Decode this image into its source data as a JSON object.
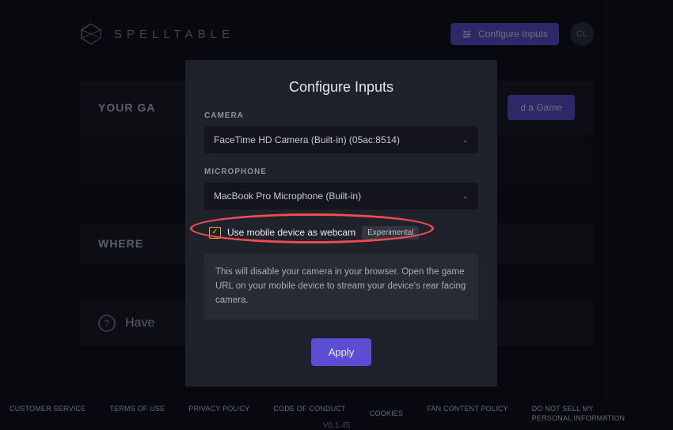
{
  "brand": {
    "name": "SPELLTABLE"
  },
  "topbar": {
    "config_label": "Configure Inputs",
    "avatar_initials": "CL"
  },
  "sections": {
    "your_games": "YOUR GA",
    "find_game": "d a Game",
    "where_to": "WHERE",
    "have_question": "Have"
  },
  "modal": {
    "title": "Configure Inputs",
    "camera_label": "CAMERA",
    "camera_value": "FaceTime HD Camera (Built-in) (05ac:8514)",
    "mic_label": "MICROPHONE",
    "mic_value": "MacBook Pro Microphone (Built-in)",
    "mobile_checkbox_label": "Use mobile device as webcam",
    "experimental_badge": "Experimental",
    "mobile_info": "This will disable your camera in your browser. Open the game URL on your mobile device to stream your device's rear facing camera.",
    "apply_label": "Apply"
  },
  "footer": {
    "customer_service": "CUSTOMER SERVICE",
    "terms": "TERMS OF USE",
    "privacy": "PRIVACY POLICY",
    "conduct": "CODE OF CONDUCT",
    "cookies": "COOKIES",
    "fan": "FAN CONTENT POLICY",
    "do_not_sell": "DO NOT SELL MY PERSONAL INFORMATION",
    "version": "V0.1.45"
  }
}
